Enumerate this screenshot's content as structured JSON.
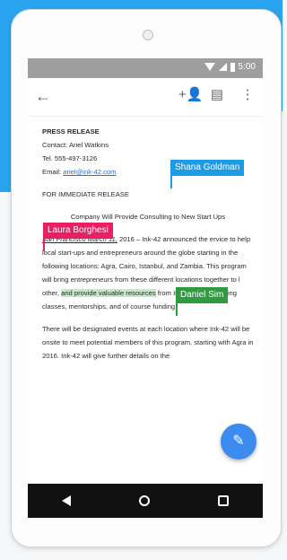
{
  "status": {
    "time": "5:00"
  },
  "appbar": {
    "back_icon": "arrow-left-icon",
    "icons": [
      "add-person-icon",
      "comment-icon",
      "more-vert-icon"
    ]
  },
  "doc": {
    "heading": "PRESS RELEASE",
    "contact": "Contact: Ariel Watkins",
    "tel": "Tel. 555-497-3126",
    "email_label": "Email:",
    "email": "ariel@ink-42.com",
    "release": "FOR IMMEDIATE RELEASE",
    "subtitle": "Company Will Provide Consulting to New Start Ups",
    "p1_lead": "San Francisco March 11,",
    "p1": " 2016 – Ink-42 announced the ",
    "p1b": "ervice to help local start-ups and entrepreneurs around the globe starting in the following locations: Agra, Cairo, Istanbul, and Zambia. This program will bring entrepreneurs from these different locations together to l",
    "p1c": " other, ",
    "p1_hl": "and provide valuable resources",
    "p1d": " from Ink-42 itself including classes, mentorships, and of course funding.",
    "p2": "There will be designated events at each location where Ink-42 will be onsite to meet potential members of this program, starting with Agra in 2016. Ink-42 will give further details on the"
  },
  "collaborators": {
    "shana": "Shana Goldman",
    "laura": "Laura Borghesi",
    "daniel": "Daniel Sim"
  },
  "colors": {
    "shana": "#1e9be5",
    "laura": "#e91e63",
    "daniel": "#2e9b3f",
    "banner": "#2aa3ef"
  }
}
